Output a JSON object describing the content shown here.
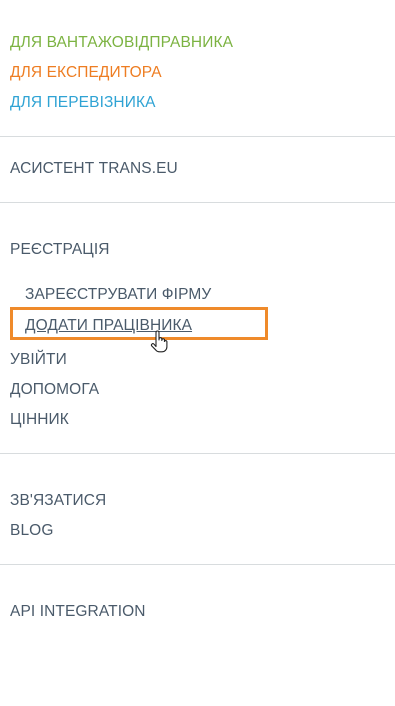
{
  "audience_links": {
    "shipper": "ДЛЯ ВАНТАЖОВІДПРАВНИКА",
    "forwarder": "ДЛЯ ЕКСПЕДИТОРА",
    "carrier": "ДЛЯ ПЕРЕВІЗНИКА"
  },
  "assistant": "АСИСТЕНТ TRANS.EU",
  "registration": {
    "label": "РЕЄСТРАЦІЯ",
    "register_company": "ЗАРЕЄСТРУВАТИ ФІРМУ",
    "add_employee": "ДОДАТИ ПРАЦІВНИКА"
  },
  "account": {
    "login": "УВІЙТИ",
    "help": "ДОПОМОГА",
    "pricing": "ЦІННИК"
  },
  "contact": {
    "contact_us": "ЗВ'ЯЗАТИСЯ",
    "blog": "BLOG"
  },
  "api": "API INTEGRATION",
  "colors": {
    "shipper": "#7cb342",
    "forwarder": "#ee7d22",
    "carrier": "#2fa3d4",
    "highlight": "#ef8a2a"
  },
  "icons": {
    "cursor": "hand-pointer-icon"
  }
}
